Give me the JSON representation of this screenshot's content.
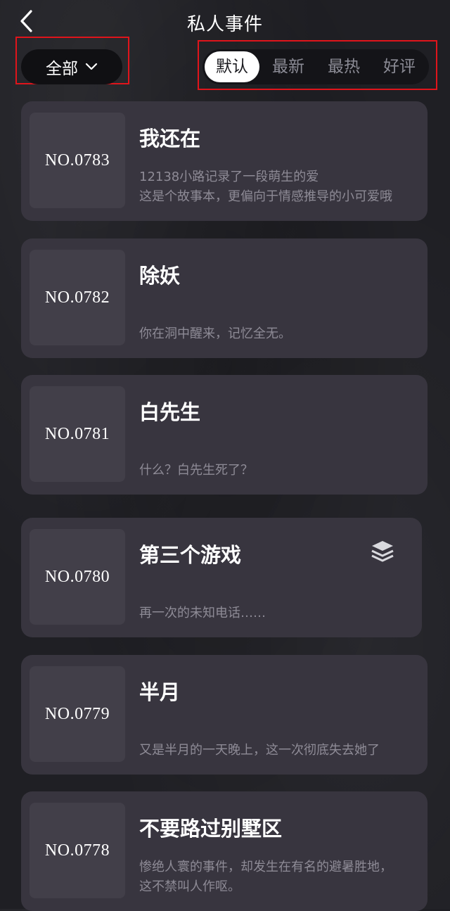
{
  "header": {
    "title": "私人事件",
    "back_icon": "chevron-left-icon"
  },
  "filter": {
    "selected": "全部",
    "icon": "chevron-down-icon"
  },
  "sort": {
    "tabs": [
      "默认",
      "最新",
      "最热",
      "好评"
    ],
    "active_index": 0
  },
  "cards": [
    {
      "number": "NO.0783",
      "title": "我还在",
      "desc_lines": [
        "12138小路记录了一段萌生的爱",
        "这是个故事本，更偏向于情感推导的小可爱哦"
      ]
    },
    {
      "number": "NO.0782",
      "title": "除妖",
      "desc_lines": [
        "你在洞中醒来，记忆全无。"
      ]
    },
    {
      "number": "NO.0781",
      "title": "白先生",
      "desc_lines": [
        "什么？白先生死了？"
      ]
    },
    {
      "number": "NO.0780",
      "title": "第三个游戏",
      "desc_lines": [
        "再一次的未知电话……"
      ],
      "icon": "stack-layers-icon"
    },
    {
      "number": "NO.0779",
      "title": "半月",
      "desc_lines": [
        "又是半月的一天晚上，这一次彻底失去她了"
      ]
    },
    {
      "number": "NO.0778",
      "title": "不要路过别墅区",
      "desc_lines": [
        "惨绝人寰的事件，却发生在有名的避暑胜地，",
        "这不禁叫人作呕。"
      ]
    }
  ],
  "colors": {
    "background": "#1f1f24",
    "card": "#38353f",
    "number_tile": "#423f49",
    "highlight_border": "#e0141b"
  }
}
